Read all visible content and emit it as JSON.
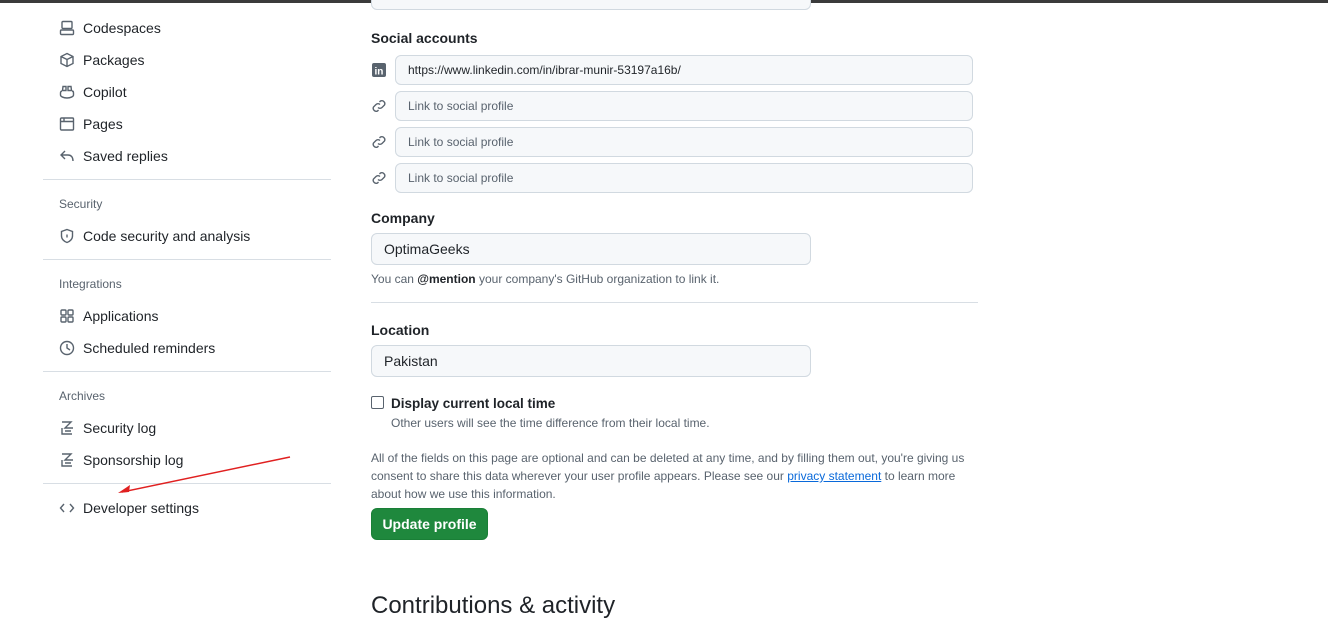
{
  "sidebar": {
    "items_top": [
      {
        "label": "Codespaces",
        "icon": "codespaces-icon"
      },
      {
        "label": "Packages",
        "icon": "package-icon"
      },
      {
        "label": "Copilot",
        "icon": "copilot-icon"
      },
      {
        "label": "Pages",
        "icon": "browser-icon"
      },
      {
        "label": "Saved replies",
        "icon": "reply-icon"
      }
    ],
    "security": {
      "heading": "Security",
      "items": [
        {
          "label": "Code security and analysis"
        }
      ]
    },
    "integrations": {
      "heading": "Integrations",
      "items": [
        {
          "label": "Applications"
        },
        {
          "label": "Scheduled reminders"
        }
      ]
    },
    "archives": {
      "heading": "Archives",
      "items": [
        {
          "label": "Security log"
        },
        {
          "label": "Sponsorship log"
        }
      ]
    },
    "developer": {
      "label": "Developer settings"
    }
  },
  "main": {
    "social": {
      "label": "Social accounts",
      "links": [
        {
          "value": "https://www.linkedin.com/in/ibrar-munir-53197a16b/",
          "placeholder": ""
        },
        {
          "value": "",
          "placeholder": "Link to social profile"
        },
        {
          "value": "",
          "placeholder": "Link to social profile"
        },
        {
          "value": "",
          "placeholder": "Link to social profile"
        }
      ]
    },
    "company": {
      "label": "Company",
      "value": "OptimaGeeks",
      "note_pre": "You can ",
      "note_mention": "@mention",
      "note_post": " your company's GitHub organization to link it."
    },
    "location": {
      "label": "Location",
      "value": "Pakistan"
    },
    "local_time": {
      "label": "Display current local time",
      "note": "Other users will see the time difference from their local time.",
      "checked": false
    },
    "disclaimer": {
      "pre": "All of the fields on this page are optional and can be deleted at any time, and by filling them out, you're giving us consent to share this data wherever your user profile appears. Please see our ",
      "link": "privacy statement",
      "post": " to learn more about how we use this information."
    },
    "update_button": "Update profile",
    "next_heading": "Contributions & activity"
  },
  "annotation_color": "#e02020"
}
